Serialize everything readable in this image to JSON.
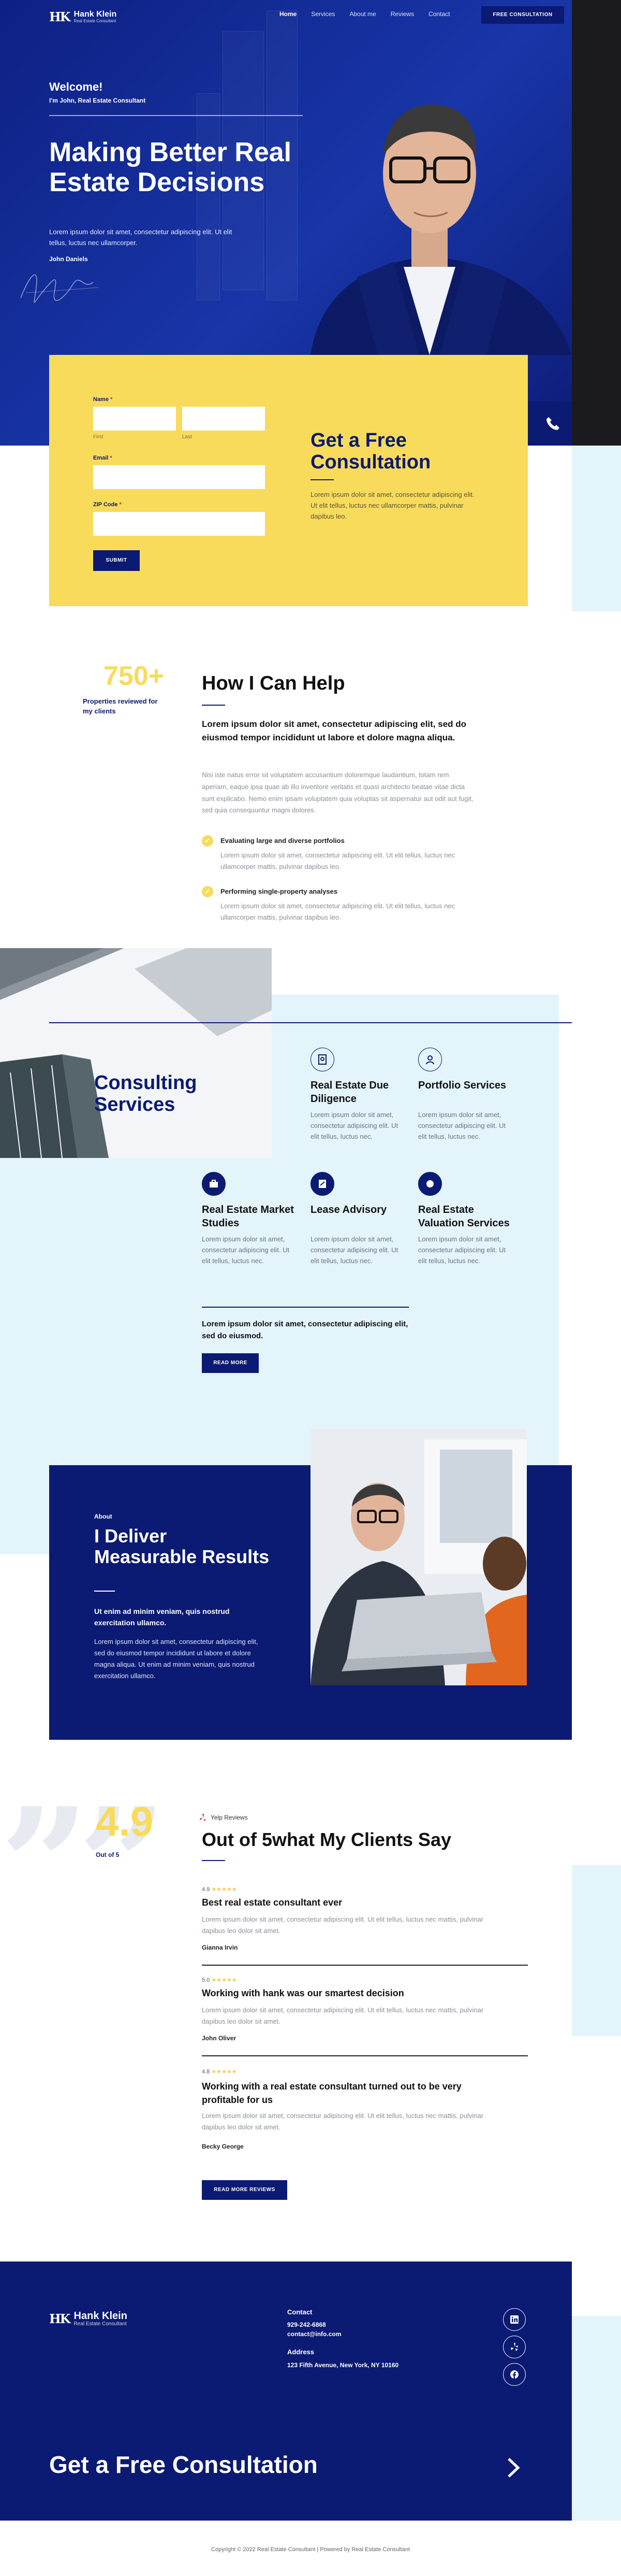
{
  "brand": {
    "name": "Hank Klein",
    "tagline": "Real Estate Consultant",
    "mark": "HK"
  },
  "nav": {
    "items": [
      "Home",
      "Services",
      "About me",
      "Reviews",
      "Contact"
    ],
    "cta": "FREE CONSULTATION"
  },
  "hero": {
    "welcome": "Welcome!",
    "subtitle": "I'm John, Real Estate Consultant",
    "title": "Making Better Real Estate Decisions",
    "text": "Lorem ipsum dolor sit amet, consectetur adipiscing elit. Ut elit tellus, luctus nec ullamcorper.",
    "name": "John Daniels"
  },
  "form": {
    "name_label": "Name",
    "first_hint": "First",
    "last_hint": "Last",
    "email_label": "Email",
    "zip_label": "ZIP Code",
    "required_mark": "*",
    "submit": "SUBMIT",
    "title": "Get a Free Consultation",
    "text": "Lorem ipsum dolor sit amet, consectetur adipiscing elit. Ut elit tellus, luctus nec ullamcorper mattis, pulvinar dapibus leo."
  },
  "help": {
    "stat_value": "750+",
    "stat_label": "Properties reviewed for my clients",
    "title": "How I Can Help",
    "lead": "Lorem ipsum dolor sit amet, consectetur adipiscing elit, sed do eiusmod tempor incididunt ut labore et dolore magna aliqua.",
    "body": "Nisi iste natus error sit voluptatem accusantium doloremque laudantium, totam rem aperiam, eaque ipsa quae ab illo inventore veritatis et quasi architecto beatae vitae dicta sunt explicabo. Nemo enim ipsam voluptatem quia voluptas sit aspernatur aut odit aut fugit, sed quia consequuntur magni dolores.",
    "items": [
      {
        "title": "Evaluating large and diverse portfolios",
        "text": "Lorem ipsum dolor sit amet, consectetur adipiscing elit. Ut elit tellus, luctus nec ullamcorper mattis, pulvinar dapibus leo."
      },
      {
        "title": "Performing single-property analyses",
        "text": "Lorem ipsum dolor sit amet, consectetur adipiscing elit. Ut elit tellus, luctus nec ullamcorper mattis, pulvinar dapibus leo."
      }
    ]
  },
  "consulting": {
    "title": "Consulting Services",
    "services": [
      {
        "title": "Real Estate Due Diligence",
        "text": "Lorem ipsum dolor sit amet, consectetur adipiscing elit. Ut elit tellus, luctus nec.",
        "icon": "document-search-icon"
      },
      {
        "title": "Portfolio Services",
        "text": "Lorem ipsum dolor sit amet, consectetur adipiscing elit. Ut elit tellus, luctus nec.",
        "icon": "people-icon"
      },
      {
        "title": "Real Estate Market Studies",
        "text": "Lorem ipsum dolor sit amet, consectetur adipiscing elit. Ut elit tellus, luctus nec.",
        "icon": "briefcase-icon"
      },
      {
        "title": "Lease Advisory",
        "text": "Lorem ipsum dolor sit amet, consectetur adipiscing elit. Ut elit tellus, luctus nec.",
        "icon": "signature-icon"
      },
      {
        "title": "Real Estate Valuation Services",
        "text": "Lorem ipsum dolor sit amet, consectetur adipiscing elit. Ut elit tellus, luctus nec.",
        "icon": "circle-icon"
      }
    ],
    "cta_text": "Lorem ipsum dolor sit amet, consectetur adipiscing elit, sed do eiusmod.",
    "cta_button": "READ MORE"
  },
  "about": {
    "kicker": "About",
    "title": "I Deliver Measurable Results",
    "lead": "Ut enim ad minim veniam, quis nostrud exercitation ullamco.",
    "text": "Lorem ipsum dolor sit amet, consectetur adipiscing elit, sed do eiusmod tempor incididunt ut labore et dolore magna aliqua. Ut enim ad minim veniam, quis nostrud exercitation ullamco."
  },
  "reviews": {
    "rating": "4.9",
    "rating_label": "Out of 5",
    "source": "Yelp Reviews",
    "title": "Out of 5what My Clients Say",
    "stars": "★★★★★",
    "items": [
      {
        "score": "4.9",
        "title": "Best real estate consultant ever",
        "text": "Lorem ipsum dolor sit amet, consectetur adipiscing elit. Ut elit tellus, luctus nec mattis, pulvinar dapibus leo dolor sit amet.",
        "author": "Gianna Irvin"
      },
      {
        "score": "5.0",
        "title": "Working with hank was our smartest decision",
        "text": "Lorem ipsum dolor sit amet, consectetur adipiscing elit. Ut elit tellus, luctus nec mattis, pulvinar dapibus leo dolor sit amet.",
        "author": "John Oliver"
      },
      {
        "score": "4.8",
        "title": "Working with a real estate consultant turned out to be very profitable for us",
        "text": "Lorem ipsum dolor sit amet, consectetur adipiscing elit. Ut elit tellus, luctus nec mattis, pulvinar dapibus leo dolor sit amet.",
        "author": "Becky George"
      }
    ],
    "button": "READ MORE REVIEWS"
  },
  "footer": {
    "contact_label": "Contact",
    "phone": "929-242-6868",
    "email": "contact@info.com",
    "address_label": "Address",
    "address": "123 Fifth Avenue, New York, NY 10160",
    "cta": "Get a Free Consultation",
    "copyright": "Copyright © 2022 Real Estate Consultant | Powered by Real Estate Consultant"
  }
}
